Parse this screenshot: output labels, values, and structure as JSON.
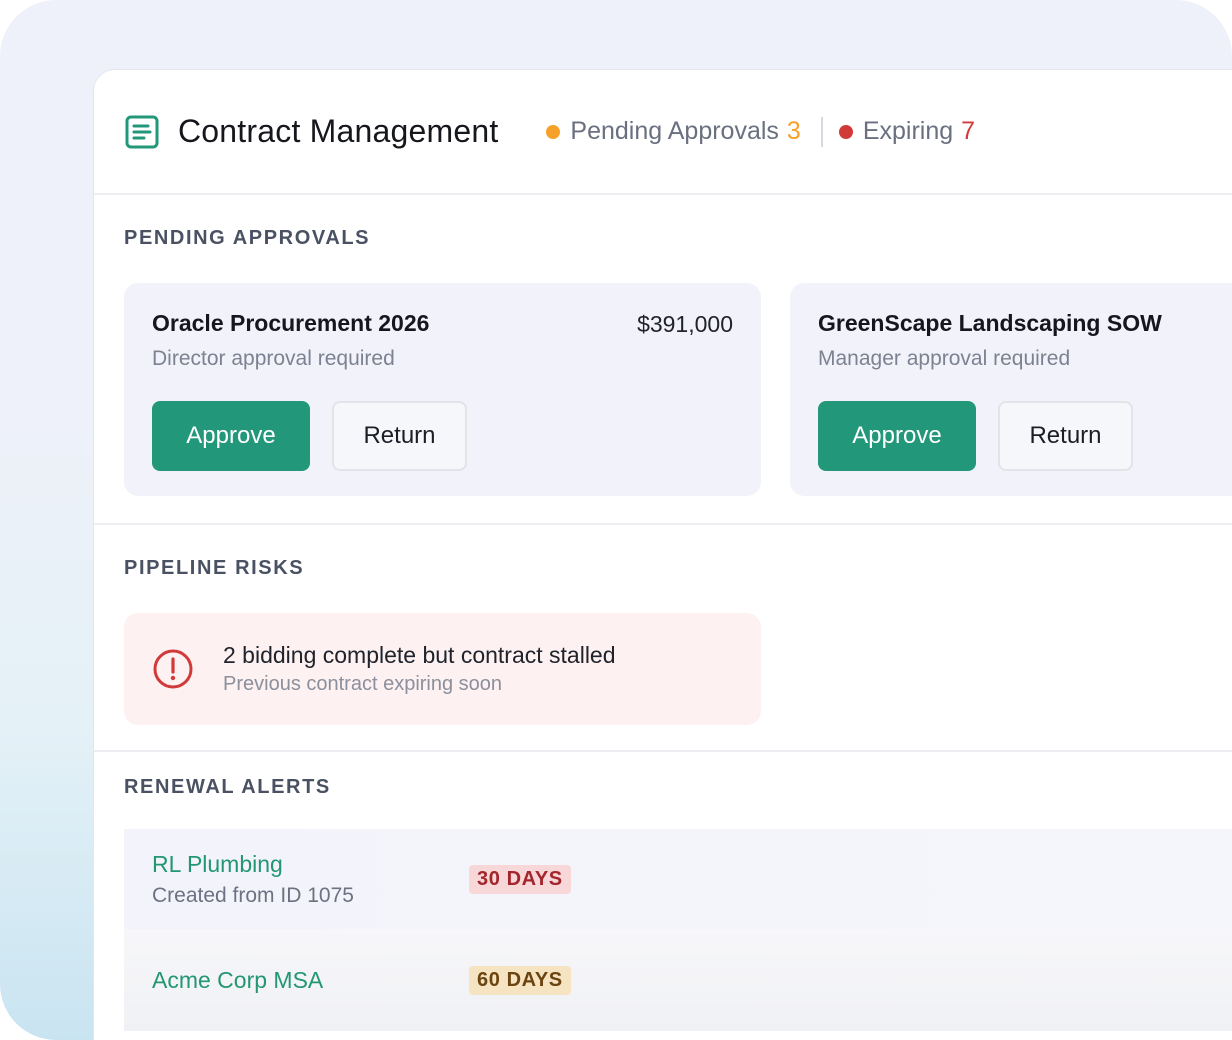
{
  "header": {
    "title": "Contract Management",
    "stats": [
      {
        "label": "Pending Approvals",
        "count": "3",
        "color": "#f5a12a"
      },
      {
        "label": "Expiring",
        "count": "7",
        "color": "#d23a3a"
      }
    ]
  },
  "approvals": {
    "title": "PENDING APPROVALS",
    "cards": [
      {
        "name": "Oracle Procurement 2026",
        "amount": "$391,000",
        "sub": "Director approval required",
        "approve_label": "Approve",
        "return_label": "Return"
      },
      {
        "name": "GreenScape Landscaping SOW",
        "amount": "",
        "sub": "Manager approval required",
        "approve_label": "Approve",
        "return_label": "Return"
      }
    ]
  },
  "risks": {
    "title": "PIPELINE RISKS",
    "items": [
      {
        "main": "2 bidding complete but contract stalled",
        "sub": "Previous contract expiring soon"
      }
    ]
  },
  "renewals": {
    "title": "RENEWAL ALERTS",
    "items": [
      {
        "name": "RL Plumbing",
        "sub": "Created from ID 1075",
        "badge": "30 DAYS"
      },
      {
        "name": "Acme Corp MSA",
        "sub": "",
        "badge": "60 DAYS"
      }
    ]
  },
  "colors": {
    "accent": "#22977a",
    "danger": "#d23a3a",
    "warning": "#f5a12a"
  }
}
